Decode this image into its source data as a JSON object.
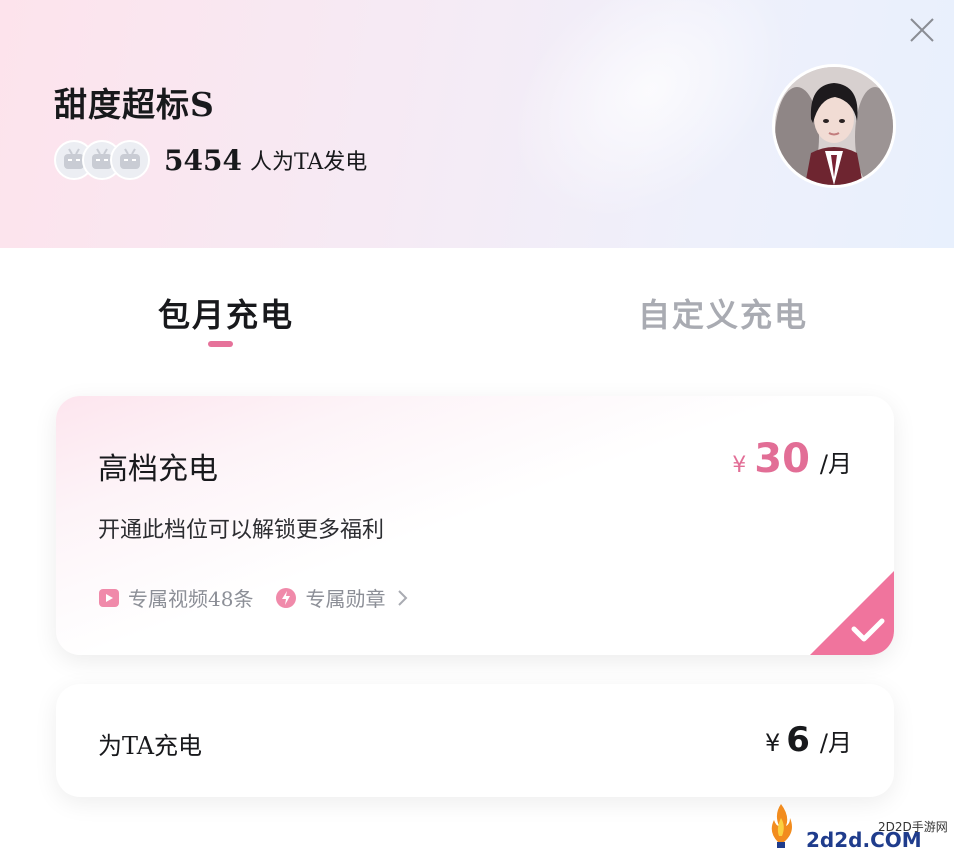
{
  "header": {
    "title": "甜度超标S",
    "supporter_count": "5454",
    "supporter_suffix": "人为TA发电"
  },
  "tabs": [
    {
      "label": "包月充电",
      "active": true
    },
    {
      "label": "自定义充电",
      "active": false
    }
  ],
  "tiers": [
    {
      "name": "高档充电",
      "currency": "¥",
      "price": "30",
      "unit": "/月",
      "description": "开通此档位可以解锁更多福利",
      "benefits": [
        "专属视频48条",
        "专属勋章"
      ],
      "selected": true
    },
    {
      "name": "为TA充电",
      "currency": "¥",
      "price": "6",
      "unit": "/月",
      "selected": false
    }
  ],
  "watermark": {
    "small": "2D2D手游网",
    "big": "2d2d.COM"
  },
  "colors": {
    "accent": "#e6729a",
    "price": "#e26e96",
    "inactive_tab": "#a9abb2"
  }
}
